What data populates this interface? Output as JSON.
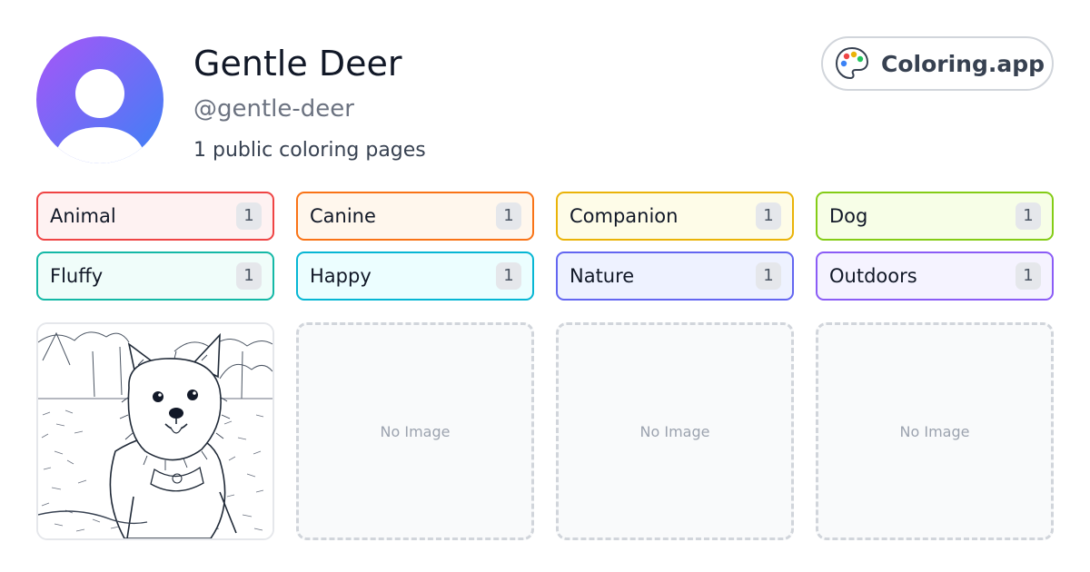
{
  "profile": {
    "name": "Gentle Deer",
    "handle": "@gentle-deer",
    "page_count": "1 public coloring pages",
    "avatar_icon": "user-silhouette-icon",
    "avatar_gradient": [
      "#a855f7",
      "#3b82f6"
    ]
  },
  "brand": {
    "label": "Coloring.app",
    "icon": "palette-icon"
  },
  "tags": [
    {
      "name": "Animal",
      "count": "1",
      "border": "#ef4444",
      "bg": "#fef2f2"
    },
    {
      "name": "Canine",
      "count": "1",
      "border": "#f97316",
      "bg": "#fff7ed"
    },
    {
      "name": "Companion",
      "count": "1",
      "border": "#eab308",
      "bg": "#fefce8"
    },
    {
      "name": "Dog",
      "count": "1",
      "border": "#84cc16",
      "bg": "#f7fee7"
    },
    {
      "name": "Fluffy",
      "count": "1",
      "border": "#14b8a6",
      "bg": "#f0fdfa"
    },
    {
      "name": "Happy",
      "count": "1",
      "border": "#06b6d4",
      "bg": "#ecfeff"
    },
    {
      "name": "Nature",
      "count": "1",
      "border": "#6366f1",
      "bg": "#eef2ff"
    },
    {
      "name": "Outdoors",
      "count": "1",
      "border": "#8b5cf6",
      "bg": "#f5f3ff"
    }
  ],
  "gallery": {
    "items": [
      {
        "kind": "image",
        "subject": "fluffy-dog-coloring-page"
      },
      {
        "kind": "empty",
        "label": "No Image"
      },
      {
        "kind": "empty",
        "label": "No Image"
      },
      {
        "kind": "empty",
        "label": "No Image"
      }
    ]
  }
}
